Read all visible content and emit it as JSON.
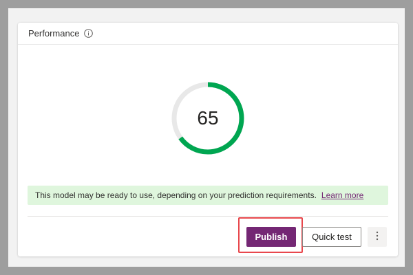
{
  "card": {
    "title": "Performance",
    "info_icon": "info-icon"
  },
  "gauge": {
    "value": "65",
    "score": 65,
    "max": 100,
    "track_color": "#e8e8e8",
    "fill_color": "#00a651"
  },
  "banner": {
    "message": "This model may be ready to use, depending on your prediction requirements.",
    "link_label": "Learn more",
    "background": "#dff6dd"
  },
  "actions": {
    "publish_label": "Publish",
    "quick_test_label": "Quick test",
    "more_icon": "more-vertical-icon",
    "primary_color": "#742774",
    "highlight_color": "#e8474c"
  }
}
